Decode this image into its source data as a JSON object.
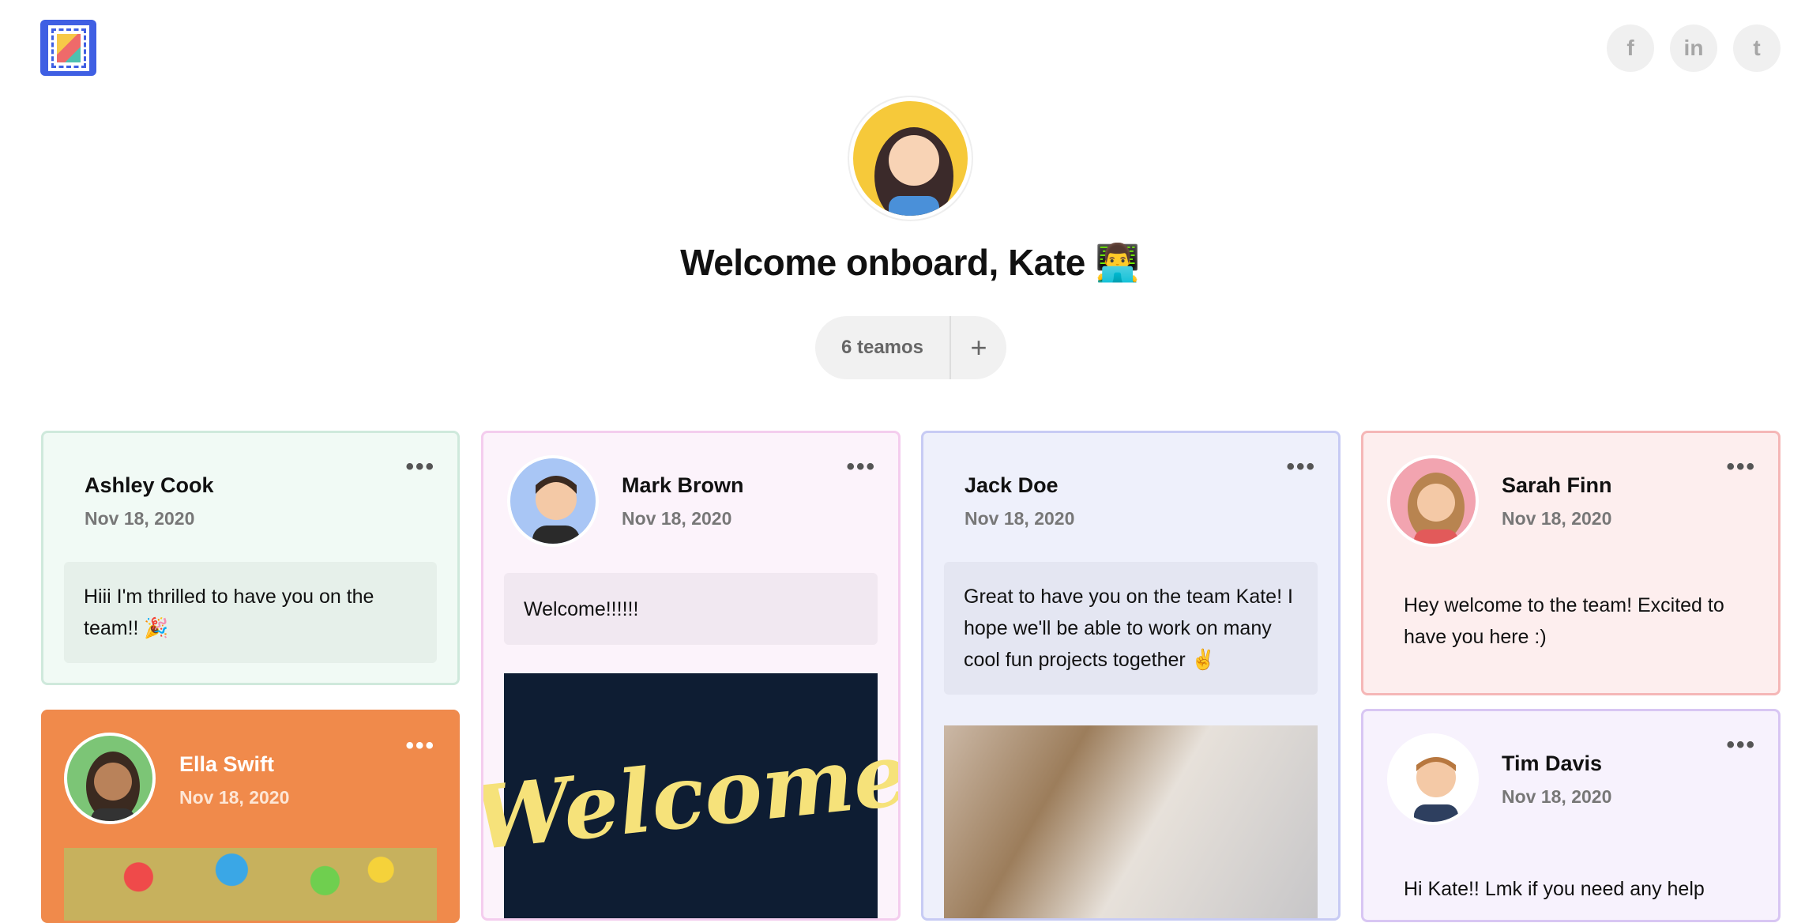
{
  "social": [
    "f",
    "in",
    "t"
  ],
  "hero": {
    "title": "Welcome onboard, Kate 👨‍💻"
  },
  "counter": {
    "label": "6 teamos",
    "add": "+"
  },
  "menu_glyph": "•••",
  "cards": [
    {
      "name": "Ashley Cook",
      "date": "Nov 18, 2020",
      "message": "Hiii I'm thrilled to have you on the team!! 🎉"
    },
    {
      "name": "Mark Brown",
      "date": "Nov 18, 2020",
      "message": "Welcome!!!!!!",
      "image_text": "Welcome"
    },
    {
      "name": "Jack Doe",
      "date": "Nov 18, 2020",
      "message": "Great to have you on the team Kate! I hope we'll be able to work on many cool fun projects together ✌️"
    },
    {
      "name": "Sarah Finn",
      "date": "Nov 18, 2020",
      "message": "Hey welcome to the team! Excited to have you here :)"
    },
    {
      "name": "Ella Swift",
      "date": "Nov 18, 2020"
    },
    {
      "name": "Tim Davis",
      "date": "Nov 18, 2020",
      "message": "Hi Kate!! Lmk if you need any help"
    }
  ]
}
